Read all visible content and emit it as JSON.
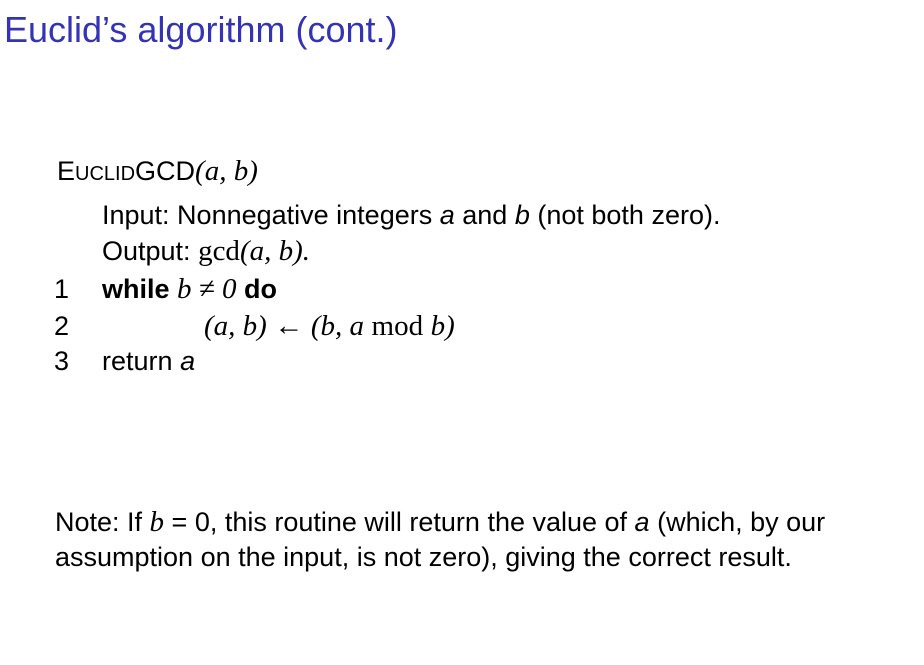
{
  "title": "Euclid’s algorithm (cont.)",
  "procedure": {
    "name_first": "E",
    "name_rest": "UCLID",
    "name_tail": "GCD",
    "signature": "(a, b)"
  },
  "input_line": {
    "label": "Input: Nonnegative integers ",
    "var_a": "a",
    "and": " and ",
    "var_b": "b",
    "rest": " (not both zero)."
  },
  "output_line": {
    "label": "Output: ",
    "func": "gcd",
    "args": "(a, b)."
  },
  "lines": [
    {
      "number": "1",
      "keyword": "while",
      "condition": "b ≠ 0",
      "keyword2": "do"
    },
    {
      "number": "2",
      "lhs": "(a, b)",
      "arrow": "←",
      "rhs_open": "(b, a",
      "mod": "mod",
      "rhs_close": "b)"
    },
    {
      "number": "3",
      "keyword": "return",
      "value": "a"
    }
  ],
  "note": {
    "prefix": "Note: If ",
    "var_b": "b",
    "eq": " = 0, this routine will return the value of ",
    "var_a": "a",
    "suffix": " (which, by our assumption on the input, is not zero), giving the correct result."
  }
}
